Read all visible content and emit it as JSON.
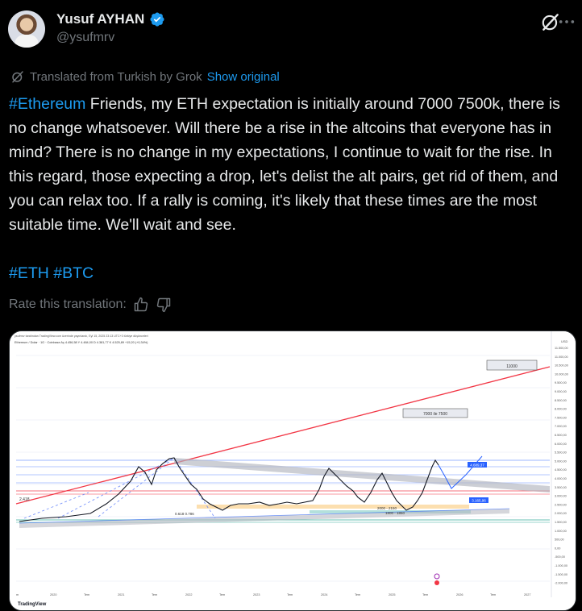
{
  "author": {
    "display_name": "Yusuf AYHAN",
    "handle": "@ysufmrv",
    "verified": true
  },
  "icons": {
    "verified": "verified-badge-icon",
    "grok": "grok-icon",
    "more": "more-icon",
    "translate": "translate-icon",
    "thumbs_up": "thumbs-up-icon",
    "thumbs_down": "thumbs-down-icon"
  },
  "translation": {
    "notice": "Translated from Turkish by Grok",
    "show_original": "Show original",
    "rate_label": "Rate this translation:"
  },
  "tweet": {
    "hashtag_1": "#Ethereum",
    "body": "  Friends, my ETH expectation is initially around 7000 7500k, there is no change whatsoever. Will there be a rise in the altcoins that everyone has in mind? There is no change in my expectations, I continue to wait for the rise. In this regard, those expecting a drop, let's delist the alt pairs, get rid of them, and you can relax too. If a rally is coming, it's likely that these times are the most suitable time. We'll wait and see.",
    "hashtag_2": "#ETH",
    "hashtag_3": "#BTC"
  },
  "chart": {
    "top_note": "ysufmrv tarafından TradingView.com üzerinde yayınlandı, Eyl 15, 2025 23:13 UTC+3 türkiye düşünceleri",
    "symbol_line": "Ethereum / Dolar · 1G · Coinbase  Aç 4.456,58  Y 4.484,00  D 4.381,77  K 4.525,89  +15,20 (+0,34%)",
    "box_top": "11000",
    "box_mid": "7000 ile 7500",
    "label_left": "2.418",
    "label_fib": "0.618 0.786",
    "label_zone": "2000 - 2150",
    "label_zone2": "1800 - 1850",
    "price_tag_1": "4.689,37",
    "price_tag_2": "3.165,96",
    "axis_right_top": "USD",
    "y_ticks": [
      "11.500,00",
      "11.000,00",
      "10.500,00",
      "10.000,00",
      "9.500,00",
      "9.000,00",
      "8.500,00",
      "8.000,00",
      "7.500,00",
      "7.000,00",
      "6.500,00",
      "6.000,00",
      "5.500,00",
      "5.000,00",
      "4.500,00",
      "4.000,00",
      "3.500,00",
      "3.000,00",
      "2.500,00",
      "2.000,00",
      "1.500,00",
      "1.000,00",
      "500,00",
      "0,00",
      "-500,00",
      "-1.000,00",
      "-1.500,00",
      "-2.000,00"
    ],
    "x_ticks": [
      "m",
      "2020",
      "Tem",
      "2021",
      "Tem",
      "2022",
      "Tem",
      "2023",
      "Tem",
      "2024",
      "Tem",
      "2025",
      "Tem",
      "2026",
      "Tem",
      "2027"
    ],
    "brand": "TradingView",
    "colors": {
      "trend_red": "#f23645",
      "channel_grey": "#b2b5be",
      "price_line": "#2962ff",
      "candles": "#131722",
      "support_green": "#089981",
      "zone_orange": "#f7a21b"
    }
  }
}
